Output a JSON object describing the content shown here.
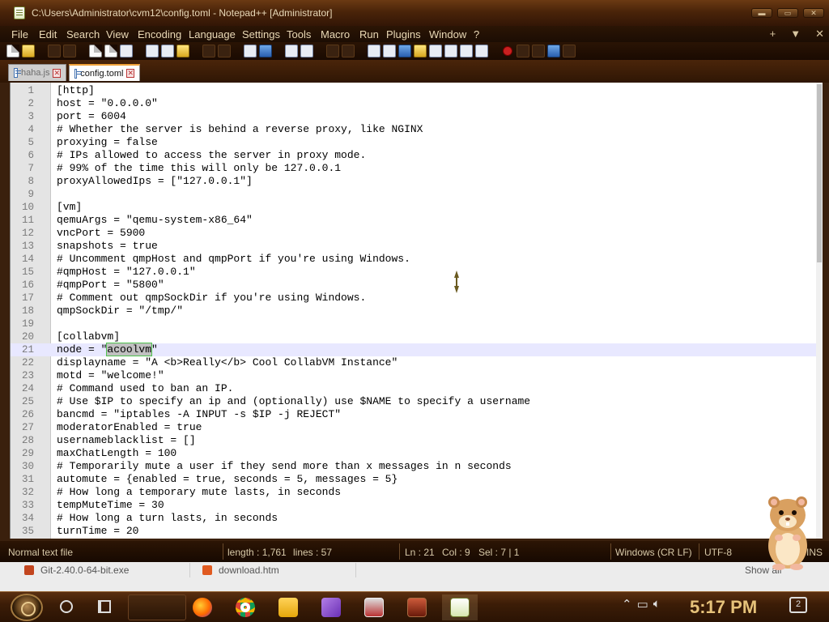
{
  "window": {
    "title": "C:\\Users\\Administrator\\cvm12\\config.toml - Notepad++ [Administrator]",
    "controls": [
      "minimize",
      "maximize",
      "close"
    ]
  },
  "menu": {
    "items": [
      "File",
      "Edit",
      "Search",
      "View",
      "Encoding",
      "Language",
      "Settings",
      "Tools",
      "Macro",
      "Run",
      "Plugins",
      "Window",
      "?"
    ],
    "right": [
      "+",
      "▼",
      "✕"
    ]
  },
  "toolbar": {
    "icons": [
      "new-file-icon",
      "open-file-icon",
      "save-icon",
      "save-all-icon",
      "close-icon",
      "close-all-icon",
      "print-icon",
      "cut-icon",
      "copy-icon",
      "paste-icon",
      "undo-icon",
      "redo-icon",
      "find-icon",
      "replace-icon",
      "zoom-in-icon",
      "zoom-out-icon",
      "sync-v-icon",
      "sync-h-icon",
      "word-wrap-icon",
      "all-chars-icon",
      "indent-guide-icon",
      "udl-icon",
      "doc-map-icon",
      "function-list-icon",
      "folder-workspace-icon",
      "monitoring-icon",
      "record-macro-icon",
      "stop-macro-icon",
      "play-macro-icon",
      "run-macro-icon",
      "save-macro-icon"
    ]
  },
  "tabs": [
    {
      "label": "haha.js",
      "active": false
    },
    {
      "label": "config.toml",
      "active": true
    }
  ],
  "editor": {
    "current_line": 21,
    "lines": [
      "[http]",
      "host = \"0.0.0.0\"",
      "port = 6004",
      "# Whether the server is behind a reverse proxy, like NGINX",
      "proxying = false",
      "# IPs allowed to access the server in proxy mode.",
      "# 99% of the time this will only be 127.0.0.1",
      "proxyAllowedIps = [\"127.0.0.1\"]",
      "",
      "[vm]",
      "qemuArgs = \"qemu-system-x86_64\"",
      "vncPort = 5900",
      "snapshots = true",
      "# Uncomment qmpHost and qmpPort if you're using Windows.",
      "#qmpHost = \"127.0.0.1\"",
      "#qmpPort = \"5800\"",
      "# Comment out qmpSockDir if you're using Windows.",
      "qmpSockDir = \"/tmp/\"",
      "",
      "[collabvm]",
      "node = \"acoolvm\"",
      "displayname = \"A <b>Really</b> Cool CollabVM Instance\"",
      "motd = \"welcome!\"",
      "# Command used to ban an IP.",
      "# Use $IP to specify an ip and (optionally) use $NAME to specify a username",
      "bancmd = \"iptables -A INPUT -s $IP -j REJECT\"",
      "moderatorEnabled = true",
      "usernameblacklist = []",
      "maxChatLength = 100",
      "# Temporarily mute a user if they send more than x messages in n seconds",
      "automute = {enabled = true, seconds = 5, messages = 5}",
      "# How long a temporary mute lasts, in seconds",
      "tempMuteTime = 30",
      "# How long a turn lasts, in seconds",
      "turnTime = 20"
    ],
    "selection": {
      "line": 21,
      "prefix": "node = \"",
      "selected": "acoolvm",
      "suffix": "\""
    }
  },
  "status": {
    "filetype": "Normal text file",
    "length": "length : 1,761",
    "lines": "lines : 57",
    "ln": "Ln : 21",
    "col": "Col : 9",
    "sel": "Sel : 7 | 1",
    "eol": "Windows (CR LF)",
    "encoding": "UTF-8",
    "mode": "INS"
  },
  "background_windows": [
    "Git-2.40.0-64-bit.exe",
    "download.htm",
    "Show all"
  ],
  "taskbar": {
    "apps": [
      "firefox-icon",
      "chrome-icon",
      "file-explorer-icon",
      "visual-studio-icon",
      "printer-app-icon",
      "calendar-app-icon",
      "notepadpp-icon"
    ],
    "clock": "5:17 PM",
    "notifications": "2"
  },
  "colors": {
    "accent": "#f0a23a",
    "selection_outline": "#4fc24f",
    "current_line": "#e8e8ff",
    "clock": "#e6c27a"
  }
}
